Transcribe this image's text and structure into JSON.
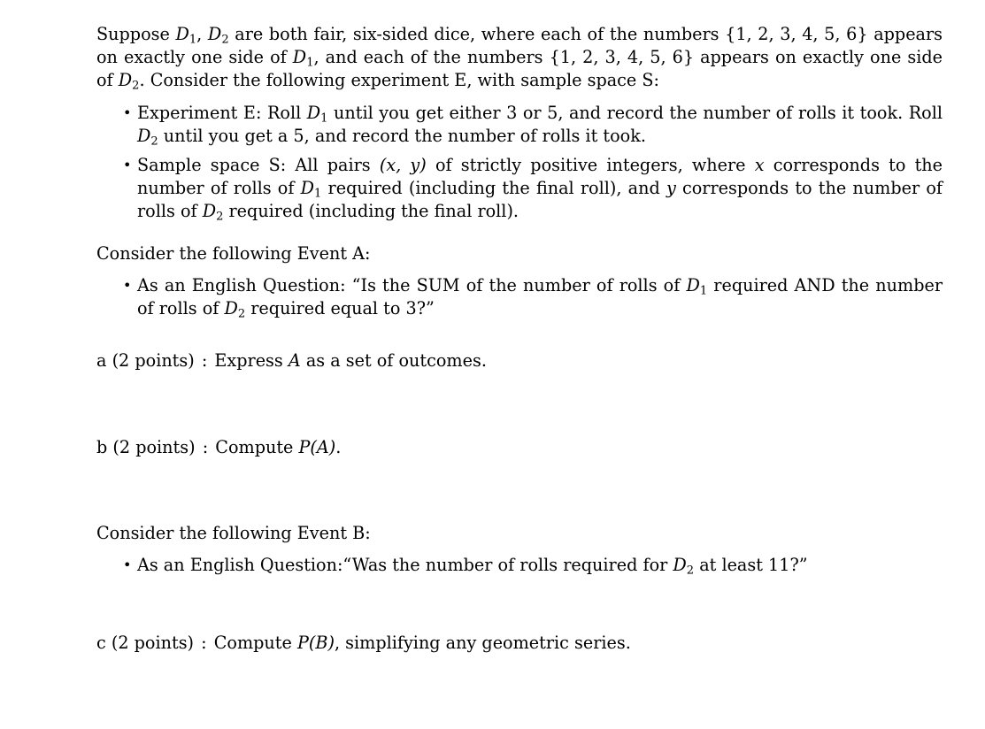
{
  "document": {
    "type": "probability-problem-set",
    "intro": {
      "prefix": "Suppose ",
      "dice": [
        "D",
        "D"
      ],
      "sentence_1_a": " are both fair, six-sided dice, where each of the numbers ",
      "set_notation": "{1, 2, 3, 4, 5, 6}",
      "sentence_1_b": " appears on exactly one side of ",
      "sentence_1_c": ", and each of the numbers ",
      "sentence_1_d": " appears on exactly one side of ",
      "sentence_1_end": ".",
      "sentence_2": "Consider the following experiment E, with sample space S:"
    },
    "experiment_bullets": [
      {
        "id": "experiment-e",
        "text_a": "Experiment E: Roll ",
        "text_b": " until you get either 3 or 5, and record the number of rolls it took. Roll ",
        "text_c": " until you get a 5, and record the number of rolls it took."
      },
      {
        "id": "sample-space-s",
        "text_a": "Sample space S: All pairs ",
        "pair_notation": "(x, y)",
        "text_b": " of strictly positive integers, where ",
        "var_x": "x",
        "text_c": " corresponds to the number of rolls of ",
        "text_d": " required (including the final roll), and ",
        "var_y": "y",
        "text_e": " corresponds to the number of rolls of ",
        "text_f": " required (including the final roll)."
      }
    ],
    "event_a": {
      "heading": "Consider the following Event A:",
      "bullet": {
        "text_a": "As an English Question: “Is the SUM of the number of rolls of ",
        "text_b": " required AND the number of rolls of ",
        "text_c": " required equal to 3?”"
      }
    },
    "event_b": {
      "heading": "Consider the following Event B:",
      "bullet": {
        "text_a": "As an English Question:“Was the number of rolls required for ",
        "text_b": " at least 11?”"
      }
    },
    "parts": [
      {
        "label": "a",
        "points": "(2 points)",
        "colon": ":",
        "text_a": "Express ",
        "var": "A",
        "text_b": " as a set of outcomes."
      },
      {
        "label": "b",
        "points": "(2 points)",
        "colon": ":",
        "text_a": "Compute ",
        "expr": "P(A)",
        "text_b": "."
      },
      {
        "label": "c",
        "points": "(2 points)",
        "colon": ":",
        "text_a": "Compute ",
        "expr": "P(B)",
        "text_b": ", simplifying any geometric series."
      }
    ],
    "symbols": {
      "bullet_glyph": "•",
      "d_letter": "D",
      "sub_1": "1",
      "sub_2": "2",
      "p_letter": "P",
      "a_letter": "A",
      "b_letter": "B"
    }
  }
}
